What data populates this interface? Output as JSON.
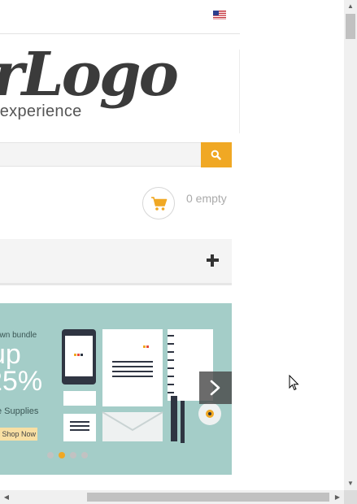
{
  "header": {
    "language_flag": "us-flag-icon"
  },
  "logo": {
    "text": "YourLogo",
    "tagline": "a new experience"
  },
  "search": {
    "placeholder": "",
    "button_icon": "search-icon"
  },
  "cart": {
    "icon": "cart-icon",
    "label": "0 empty"
  },
  "menu": {
    "toggle_icon": "plus-icon"
  },
  "banner": {
    "line1": "own bundle",
    "line2": "up",
    "line3": "25%",
    "line4": "e Supplies",
    "cta": "Shop Now",
    "next_icon": "chevron-right-icon",
    "slides_total": 4,
    "active_slide": 2,
    "colors": {
      "background": "#a4cdc8",
      "accent": "#f0a824"
    }
  },
  "scrollbars": {
    "vertical_position": 0,
    "horizontal_position": 0.28
  }
}
